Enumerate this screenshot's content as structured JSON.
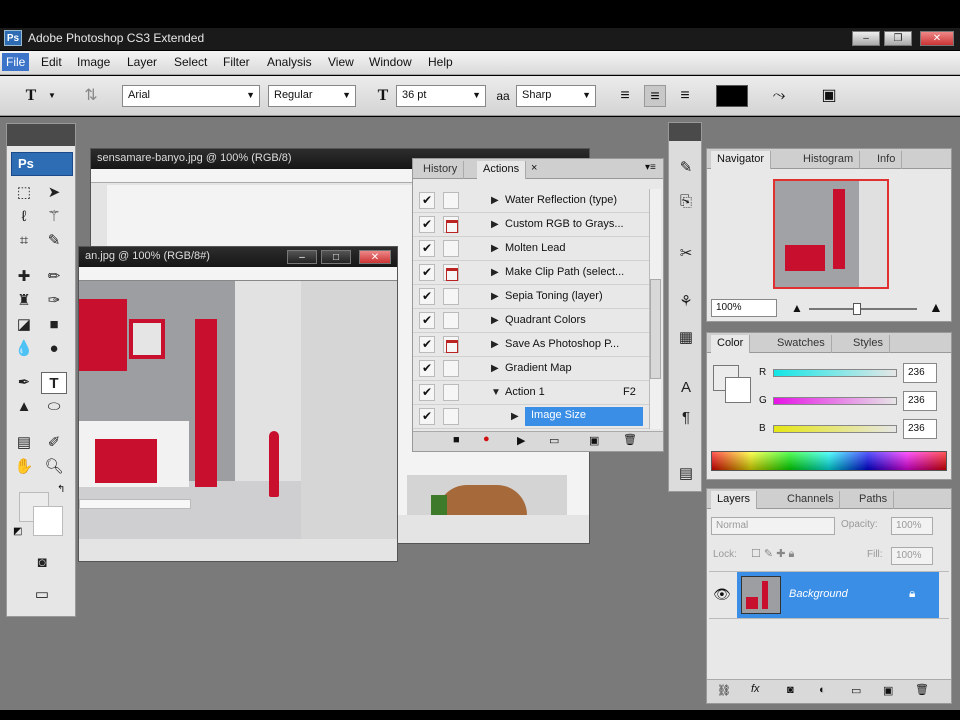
{
  "app": {
    "title": "Adobe Photoshop CS3 Extended",
    "icon": "Ps"
  },
  "menu": [
    "File",
    "Edit",
    "Image",
    "Layer",
    "Select",
    "Filter",
    "Analysis",
    "View",
    "Window",
    "Help"
  ],
  "options": {
    "tool_icon": "T",
    "font_family": "Arial",
    "font_style": "Regular",
    "font_size": "36 pt",
    "aa_label": "aa",
    "antialias": "Sharp",
    "text_color": "#000000"
  },
  "tools": {
    "badge": "Ps"
  },
  "documents": {
    "back": {
      "title": "sensamare-banyo.jpg @ 100% (RGB/8)"
    },
    "front": {
      "title": "an.jpg @ 100% (RGB/8#)"
    }
  },
  "actions_panel": {
    "tabs": [
      "History",
      "Actions"
    ],
    "active_tab": "Actions",
    "items": [
      {
        "label": "Water Reflection (type)",
        "checked": true,
        "dialog": false
      },
      {
        "label": "Custom RGB to Grays...",
        "checked": true,
        "dialog": true
      },
      {
        "label": "Molten Lead",
        "checked": true,
        "dialog": false
      },
      {
        "label": "Make Clip Path (select...",
        "checked": true,
        "dialog": true
      },
      {
        "label": "Sepia Toning (layer)",
        "checked": true,
        "dialog": false
      },
      {
        "label": "Quadrant Colors",
        "checked": true,
        "dialog": false
      },
      {
        "label": "Save As Photoshop P...",
        "checked": true,
        "dialog": true
      },
      {
        "label": "Gradient Map",
        "checked": true,
        "dialog": false
      },
      {
        "label": "Action 1",
        "checked": true,
        "dialog": false,
        "key": "F2",
        "expanded": true
      },
      {
        "label": "Image Size",
        "checked": true,
        "dialog": false,
        "selected": true
      }
    ]
  },
  "navigator": {
    "tabs": [
      "Navigator",
      "Histogram",
      "Info"
    ],
    "zoom": "100%"
  },
  "color_panel": {
    "tabs": [
      "Color",
      "Swatches",
      "Styles"
    ],
    "channels": [
      {
        "name": "R",
        "value": "236"
      },
      {
        "name": "G",
        "value": "236"
      },
      {
        "name": "B",
        "value": "236"
      }
    ]
  },
  "layers_panel": {
    "tabs": [
      "Layers",
      "Channels",
      "Paths"
    ],
    "blend_mode": "Normal",
    "opacity_label": "Opacity:",
    "opacity": "100%",
    "lock_label": "Lock:",
    "fill_label": "Fill:",
    "fill": "100%",
    "layer_name": "Background"
  },
  "colors": {
    "accent": "#3b8ee6",
    "brand": "#2e6db4",
    "product_red": "#c8102e"
  }
}
